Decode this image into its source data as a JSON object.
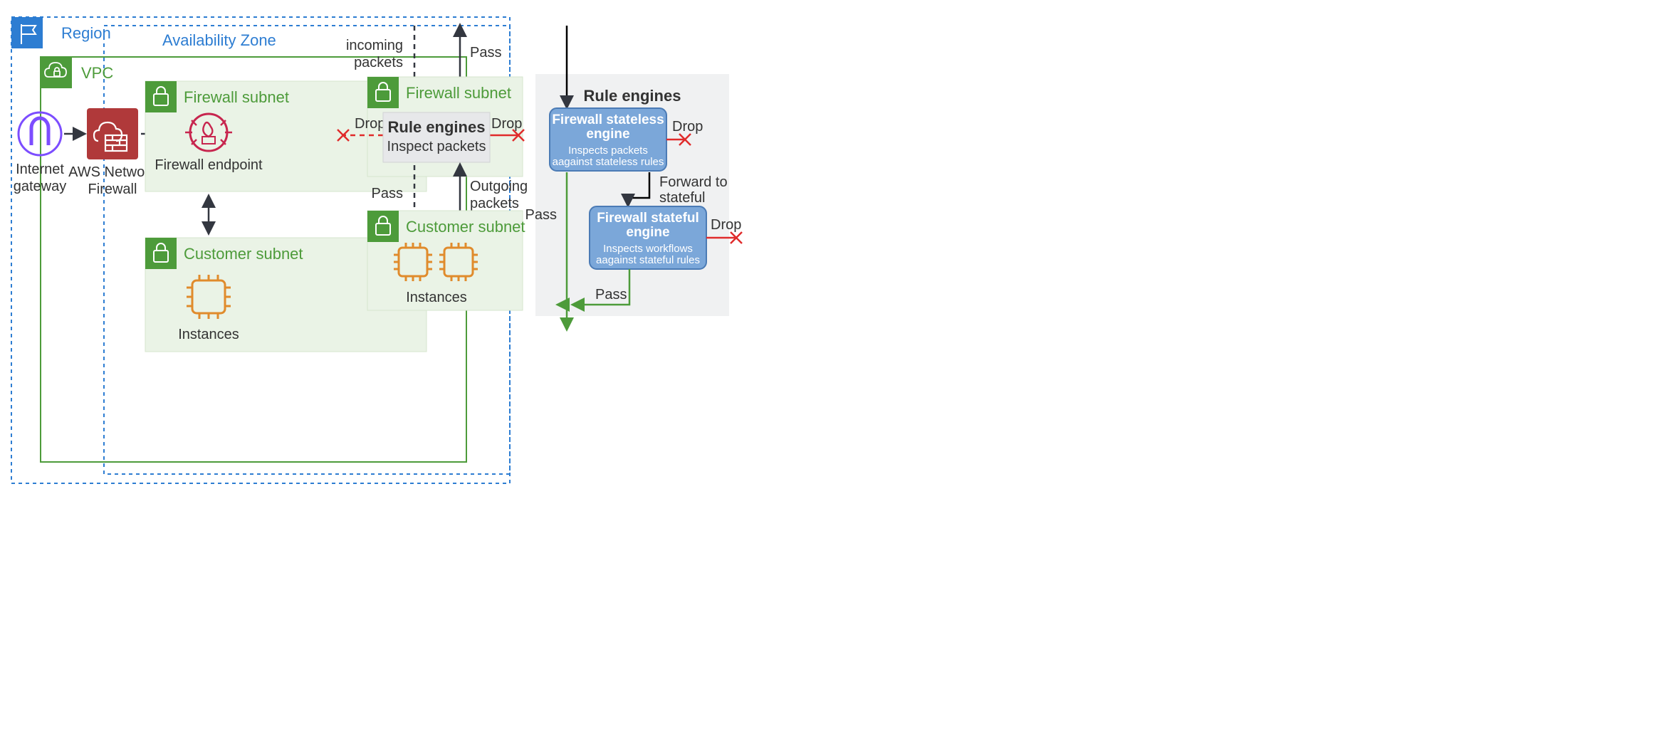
{
  "left": {
    "region": "Region",
    "az": "Availability Zone",
    "vpc": "VPC",
    "fw_subnet": "Firewall subnet",
    "cust_subnet": "Customer subnet",
    "igw1": "Internet",
    "igw2": "gateway",
    "anf1": "AWS Network",
    "anf2": "Firewall",
    "fw_endpoint": "Firewall endpoint",
    "instances": "Instances"
  },
  "mid": {
    "incoming1": "incoming",
    "incoming2": "packets",
    "pass_top": "Pass",
    "fw_subnet": "Firewall subnet",
    "drop_l": "Drop",
    "drop_r": "Drop",
    "re1": "Rule engines",
    "re2": "Inspect packets",
    "pass_bot": "Pass",
    "outgoing1": "Outgoing",
    "outgoing2": "packets",
    "cust_subnet": "Customer subnet",
    "instances": "Instances"
  },
  "right": {
    "title": "Rule engines",
    "sl1": "Firewall stateless",
    "sl2": "engine",
    "sl3": "Inspects packets",
    "sl4": "aagainst stateless rules",
    "drop1": "Drop",
    "fwd1": "Forward to",
    "fwd2": "stateful",
    "pass_l": "Pass",
    "sf1": "Firewall stateful",
    "sf2": "engine",
    "sf3": "Inspects workflows",
    "sf4": "aagainst stateful rules",
    "drop2": "Drop",
    "pass_r": "Pass"
  },
  "colors": {
    "green_fill": "#eaf3e6",
    "green_stroke": "#4d9b3a",
    "blue_dash": "#2d7dd2",
    "red": "#e02b2b",
    "dark": "#333740",
    "aws_red": "#c7254e",
    "aws_red_bg": "#c44d58",
    "orange": "#e08b2c",
    "purple": "#7c4dff",
    "grey_bg": "#f0f1f2",
    "grey_box": "#e7e8ea",
    "blue_box": "#7ba7d9"
  }
}
